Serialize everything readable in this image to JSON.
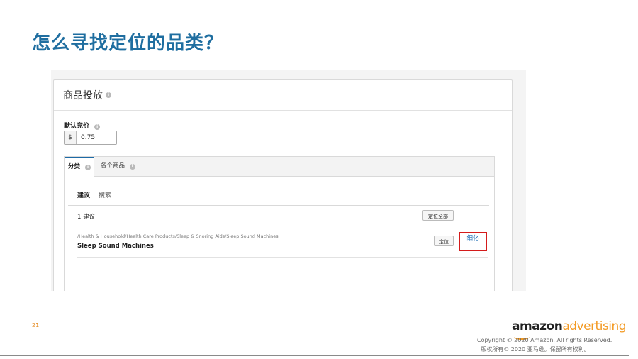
{
  "slide": {
    "title": "怎么寻找定位的品类？",
    "page_number": "21"
  },
  "screenshot": {
    "card_title": "商品投放",
    "default_bid": {
      "label": "默认竞价",
      "currency": "$",
      "value": "0.75"
    },
    "tabs": [
      {
        "label": "分类",
        "active": true
      },
      {
        "label": "各个商品",
        "active": false
      }
    ],
    "subtabs": [
      {
        "label": "建议",
        "active": true
      },
      {
        "label": "搜索",
        "active": false
      }
    ],
    "suggestion_count": "1 建议",
    "target_all_button": "定位全部",
    "category": {
      "path": "/Health & Household/Health Care Products/Sleep & Snoring Aids/Sleep Sound Machines",
      "name": "Sleep Sound Machines",
      "target_button": "定位",
      "refine_link": "细化"
    },
    "info_icon": "info-circle-icon"
  },
  "footer": {
    "logo_part1": "amazon",
    "logo_part2": "advertising",
    "copyright_en": "Copyright © 2020 Amazon. All rights Reserved.",
    "copyright_cn": "| 版权所有© 2020 亚马逊。保留所有权利。"
  },
  "colors": {
    "title": "#1f6ea0",
    "tab_accent": "#1d6aa6",
    "highlight_box": "#d41b1b",
    "link": "#1b6cb5",
    "brand_orange": "#f39a23"
  }
}
